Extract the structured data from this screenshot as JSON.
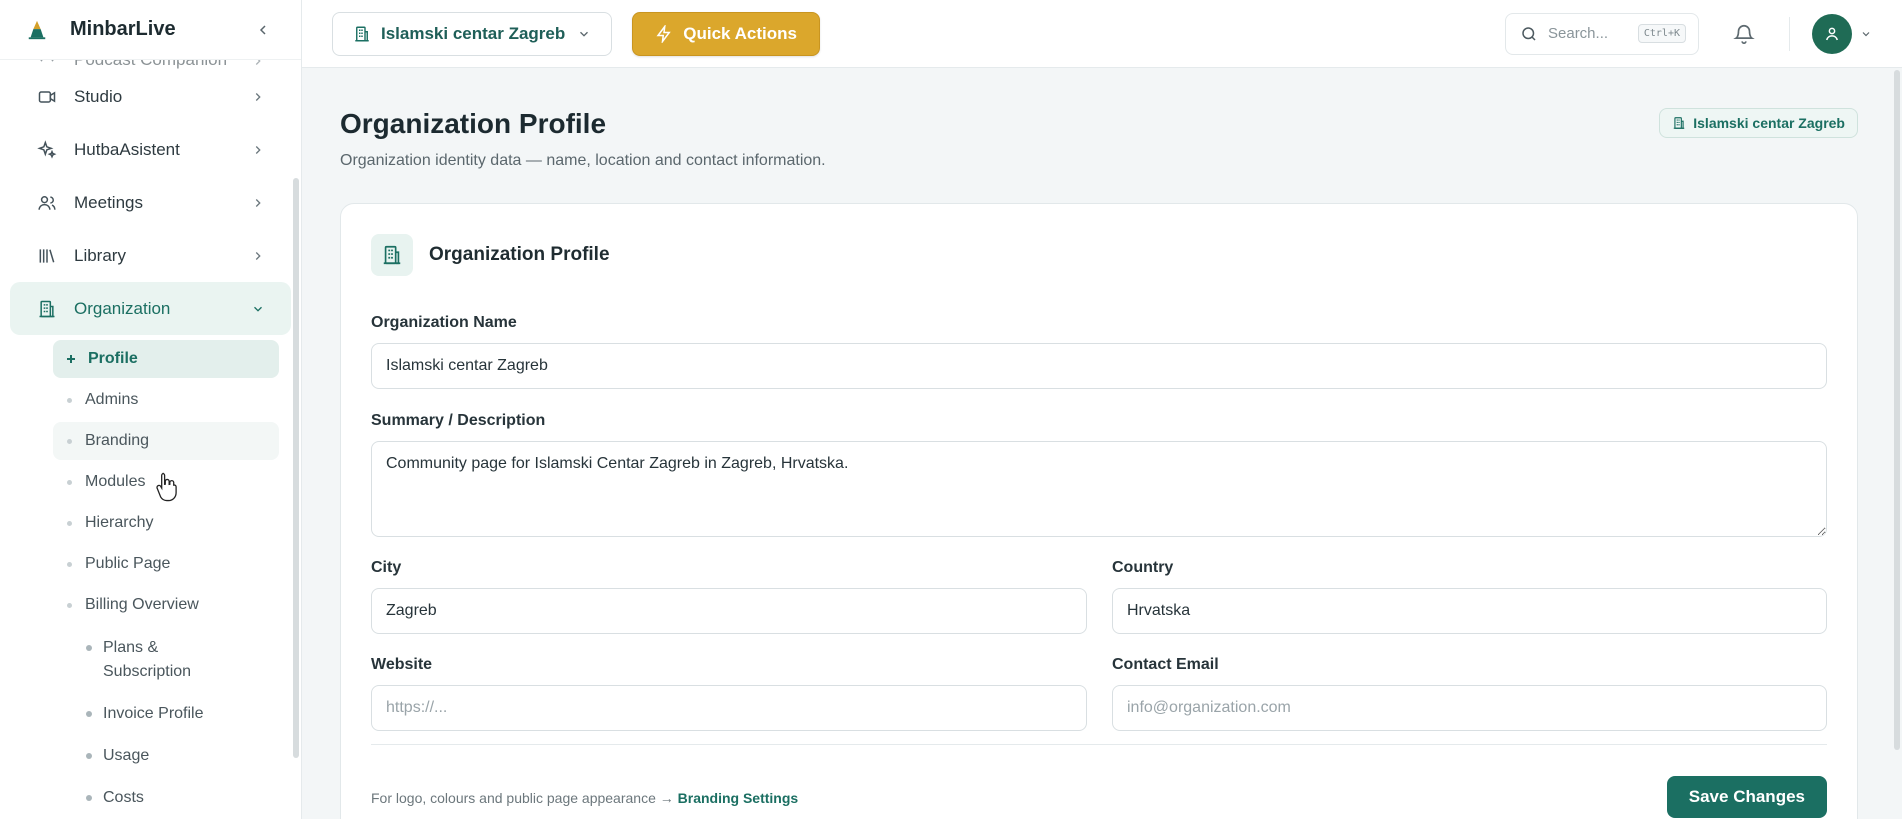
{
  "app": {
    "name": "MinbarLive"
  },
  "sidebar": {
    "items": [
      {
        "label": "Podcast Companion"
      },
      {
        "label": "Studio"
      },
      {
        "label": "HutbaAsistent"
      },
      {
        "label": "Meetings"
      },
      {
        "label": "Library"
      },
      {
        "label": "Organization"
      }
    ],
    "organization_sub": [
      {
        "label": "Profile"
      },
      {
        "label": "Admins"
      },
      {
        "label": "Branding"
      },
      {
        "label": "Modules"
      },
      {
        "label": "Hierarchy"
      },
      {
        "label": "Public Page"
      },
      {
        "label": "Billing Overview"
      }
    ],
    "billing_sub": [
      {
        "label": "Plans & Subscription"
      },
      {
        "label": "Invoice Profile"
      },
      {
        "label": "Usage"
      },
      {
        "label": "Costs"
      }
    ]
  },
  "topbar": {
    "org_selector": "Islamski centar Zagreb",
    "quick_actions": "Quick Actions",
    "search_placeholder": "Search...",
    "search_shortcut": "Ctrl+K"
  },
  "page": {
    "title": "Organization Profile",
    "subtitle": "Organization identity data — name, location and contact information.",
    "badge": "Islamski centar Zagreb"
  },
  "card": {
    "title": "Organization Profile",
    "fields": {
      "name": {
        "label": "Organization Name",
        "value": "Islamski centar Zagreb"
      },
      "summary": {
        "label": "Summary / Description",
        "value": "Community page for Islamski Centar Zagreb in Zagreb, Hrvatska."
      },
      "city": {
        "label": "City",
        "value": "Zagreb"
      },
      "country": {
        "label": "Country",
        "value": "Hrvatska"
      },
      "website": {
        "label": "Website",
        "value": "",
        "placeholder": "https://..."
      },
      "email": {
        "label": "Contact Email",
        "value": "",
        "placeholder": "info@organization.com"
      }
    },
    "footnote_text": "For logo, colours and public page appearance →",
    "footnote_link": "Branding Settings",
    "save_label": "Save Changes"
  },
  "colors": {
    "accent": "#1b6f62",
    "quick_actions": "#dba72c",
    "avatar": "#1f6b55"
  }
}
